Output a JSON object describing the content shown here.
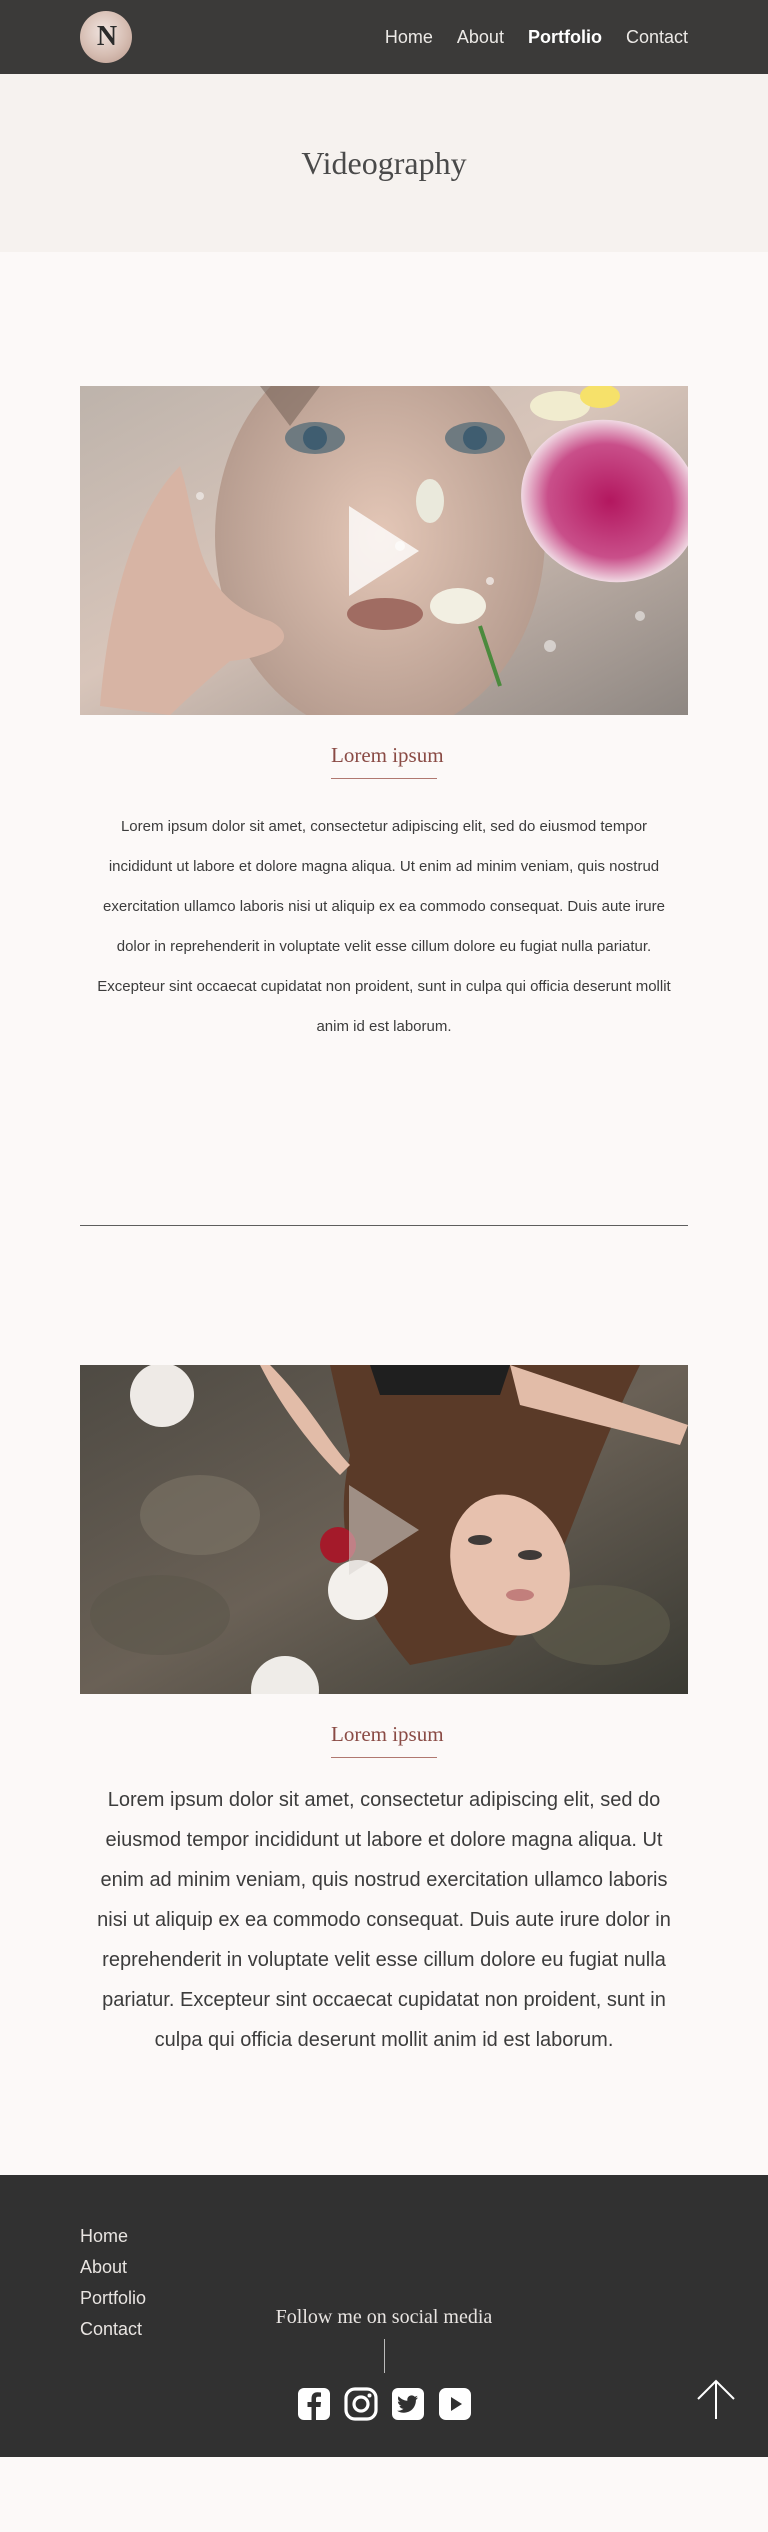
{
  "nav": {
    "logo_letter": "N",
    "links": [
      {
        "label": "Home"
      },
      {
        "label": "About"
      },
      {
        "label": "Portfolio",
        "active": true
      },
      {
        "label": "Contact"
      }
    ]
  },
  "hero": {
    "title": "Videography"
  },
  "videos": [
    {
      "title": "Lorem ipsum",
      "icon": "play-icon",
      "text": "Lorem ipsum dolor sit amet, consectetur adipiscing elit, sed do eiusmod tempor incididunt ut labore et dolore magna aliqua. Ut enim ad minim veniam, quis nostrud exercitation ullamco laboris nisi ut aliquip ex ea commodo consequat. Duis aute irure dolor in reprehenderit in voluptate velit esse cillum dolore eu fugiat nulla pariatur. Excepteur sint occaecat cupidatat non proident, sunt in culpa qui officia deserunt mollit anim id est laborum."
    },
    {
      "title": "Lorem ipsum",
      "icon": "play-icon",
      "text": "Lorem ipsum dolor sit amet, consectetur adipiscing elit, sed do eiusmod tempor incididunt ut labore et dolore magna aliqua. Ut enim ad minim veniam, quis nostrud exercitation ullamco laboris nisi ut aliquip ex ea commodo consequat. Duis aute irure dolor in reprehenderit in voluptate velit esse cillum dolore eu fugiat nulla pariatur. Excepteur sint occaecat cupidatat non proident, sunt in culpa qui officia deserunt mollit anim id est laborum."
    }
  ],
  "footer": {
    "links": [
      {
        "label": "Home"
      },
      {
        "label": "About"
      },
      {
        "label": "Portfolio"
      },
      {
        "label": "Contact"
      }
    ],
    "follow_text": "Follow me on social media",
    "socials": [
      "facebook-icon",
      "instagram-icon",
      "twitter-icon",
      "youtube-icon"
    ],
    "back_to_top_icon": "arrow-up-icon"
  }
}
